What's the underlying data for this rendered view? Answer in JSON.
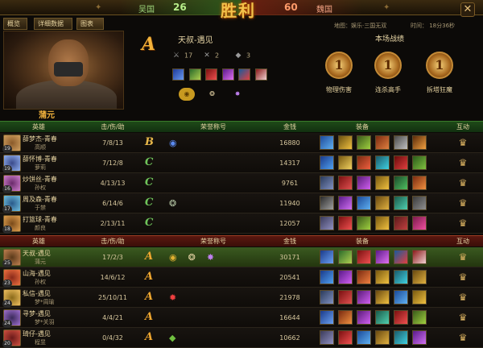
{
  "header": {
    "wu_name": "吴国",
    "wu_score": "26",
    "wei_name": "魏国",
    "wei_score": "60",
    "logo_text": "胜利",
    "map_label": "地图：娱乐·三国无双",
    "time_label": "时间： 18分36秒"
  },
  "tabs": [
    "概览",
    "详细数据",
    "图表"
  ],
  "close_label": "✕",
  "mvp": {
    "name": "蒲元",
    "title": "天叔-遇见",
    "grade": "A",
    "kills": "17",
    "deaths": "2",
    "assists": "3"
  },
  "honors": {
    "title": "本场战绩",
    "items": [
      {
        "rank": "1",
        "label": "物理伤害"
      },
      {
        "rank": "1",
        "label": "连杀高手"
      },
      {
        "rank": "1",
        "label": "拆塔狂魔"
      }
    ]
  },
  "columns": {
    "hero": "英雄",
    "kda": "击/伤/助",
    "title": "荣誉称号",
    "gold": "金钱",
    "equip": "装备",
    "interact": "互动"
  },
  "wu_players": [
    {
      "name": "薛梦杰-青春",
      "hero": "高顺",
      "level": "19",
      "kda": "7/8/13",
      "grade": "B",
      "gold": "16880"
    },
    {
      "name": "薛怀博-青春",
      "hero": "萝莉",
      "level": "19",
      "kda": "7/12/8",
      "grade": "C",
      "gold": "14317"
    },
    {
      "name": "炒饼丝-青春",
      "hero": "孙权",
      "level": "16",
      "kda": "4/13/13",
      "grade": "C",
      "gold": "9761"
    },
    {
      "name": "周及森-青春",
      "hero": "于禁",
      "level": "17",
      "kda": "6/14/6",
      "grade": "C",
      "gold": "11940"
    },
    {
      "name": "打篮球-青春",
      "hero": "颜良",
      "level": "18",
      "kda": "2/13/11",
      "grade": "C",
      "gold": "12057"
    }
  ],
  "wei_players": [
    {
      "name": "天叔-遇见",
      "hero": "蒲元",
      "level": "25",
      "kda": "17/2/3",
      "grade": "A",
      "gold": "30171"
    },
    {
      "name": "山海-遇见",
      "hero": "孙权",
      "level": "23",
      "kda": "14/6/12",
      "grade": "A",
      "gold": "20541"
    },
    {
      "name": "私信-遇见",
      "hero": "梦*周瑜",
      "level": "24",
      "kda": "25/10/11",
      "grade": "A",
      "gold": "21978"
    },
    {
      "name": "寻梦-遇见",
      "hero": "梦*关羽",
      "level": "24",
      "kda": "4/4/21",
      "grade": "A",
      "gold": "16644"
    },
    {
      "name": "琦仔-遇见",
      "hero": "程昱",
      "level": "20",
      "kda": "0/4/32",
      "grade": "A",
      "gold": "10662"
    }
  ],
  "colors": {
    "wu_team": "#2e5a1c",
    "wei_team": "#6a1e10",
    "grade_A": "#f1a830",
    "grade_C": "#6fc45a",
    "highlight_row": "#3a5a20"
  }
}
